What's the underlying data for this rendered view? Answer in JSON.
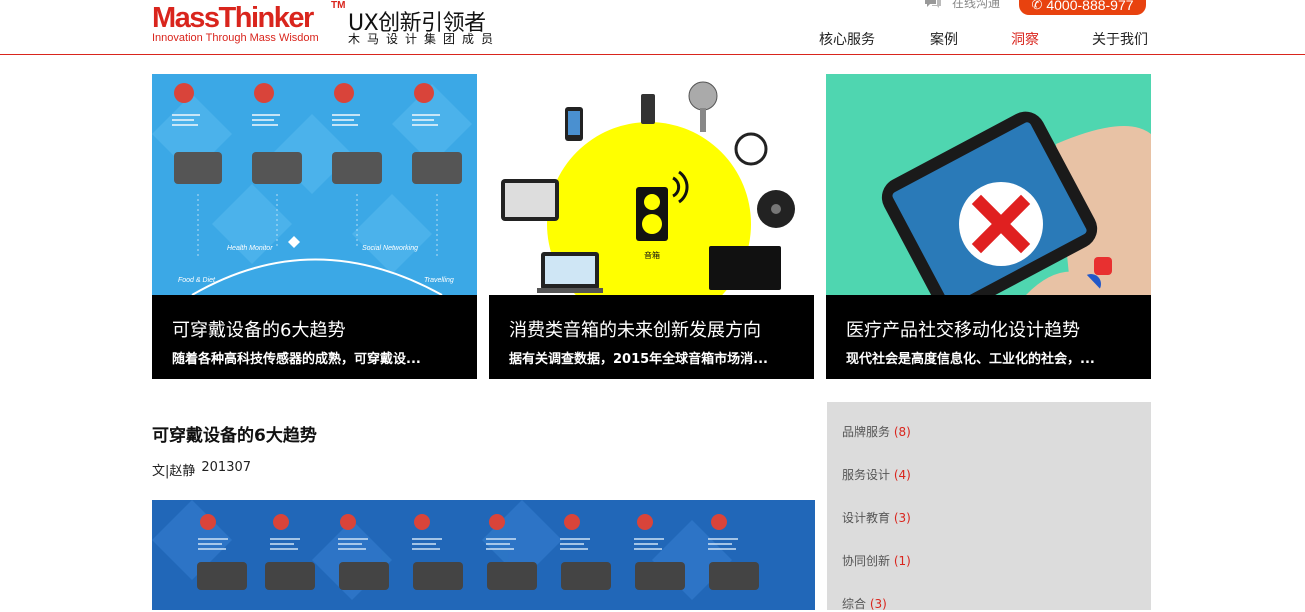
{
  "header": {
    "brand": "MassThinker",
    "trademark": "TM",
    "tagline": "Innovation Through Mass Wisdom",
    "slogan": "UX创新引领者",
    "subslogan": "木马设计集团成员",
    "chat_label": "在线沟通",
    "phone": "4000-888-977",
    "nav": [
      {
        "label": "核心服务"
      },
      {
        "label": "案例"
      },
      {
        "label": "洞察",
        "active": true
      },
      {
        "label": "关于我们"
      }
    ],
    "accent_color": "#d9251d"
  },
  "cards": [
    {
      "title": "可穿戴设备的6大趋势",
      "desc": "随着各种高科技传感器的成熟，可穿戴设...",
      "image_labels": [
        "Health Monitor",
        "Social Networking",
        "Food & Diet",
        "Travelling"
      ]
    },
    {
      "title": "消费类音箱的未来创新发展方向",
      "desc": "据有关调查数据，2015年全球音箱市场消...",
      "image_labels": [
        "音箱"
      ]
    },
    {
      "title": "医疗产品社交移动化设计趋势",
      "desc": "现代社会是高度信息化、工业化的社会，..."
    }
  ],
  "article": {
    "title": "可穿戴设备的6大趋势",
    "author": "文|赵静",
    "date": "201307"
  },
  "sidebar": {
    "categories": [
      {
        "label": "品牌服务",
        "count": "(8)"
      },
      {
        "label": "服务设计",
        "count": "(4)"
      },
      {
        "label": "设计教育",
        "count": "(3)"
      },
      {
        "label": "协同创新",
        "count": "(1)"
      },
      {
        "label": "综合",
        "count": "(3)"
      }
    ]
  }
}
